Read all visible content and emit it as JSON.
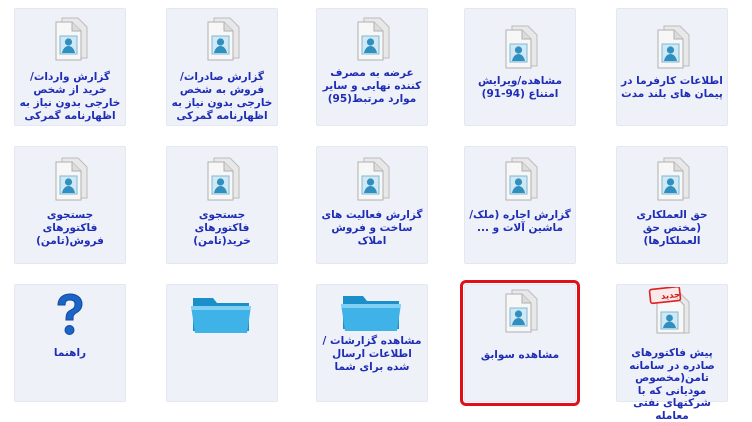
{
  "tiles": [
    {
      "label": "اطلاعات کارفرما در پیمان های بلند مدت",
      "icon": "document-user-icon"
    },
    {
      "label": "مشاهده/ویرایش امتناع (94-91)",
      "icon": "document-user-icon"
    },
    {
      "label": "عرضه به مصرف کننده نهایی و سایر موارد مرتبط(95)",
      "icon": "document-user-icon"
    },
    {
      "label": "گزارش صادرات/فروش به شخص خارجی بدون نیاز به اظهارنامه گمرکی",
      "icon": "document-user-icon"
    },
    {
      "label": "گزارش واردات/خرید از شخص خارجی بدون نیاز به اظهارنامه گمرکی",
      "icon": "document-user-icon"
    },
    {
      "label": "حق العملکاری (مختص حق العملکارها)",
      "icon": "document-user-icon"
    },
    {
      "label": "گزارش اجاره (ملک/ماشین آلات و ...",
      "icon": "document-user-icon"
    },
    {
      "label": "گزارش فعالیت های ساخت و فروش املاک",
      "icon": "document-user-icon"
    },
    {
      "label": "جستجوی فاکتورهای خرید(تامن)",
      "icon": "document-user-icon"
    },
    {
      "label": "جستجوی فاکتورهای فروش(تامن)",
      "icon": "document-user-icon"
    },
    {
      "label": "پیش فاکتورهای صادره در سامانه تامن(مخصوص مودیانی که با شرکتهای نفتی معامله",
      "icon": "new-document-icon",
      "badge": "جدید"
    },
    {
      "label": "مشاهده سوابق",
      "icon": "document-user-icon",
      "selected": true
    },
    {
      "label": "مشاهده گزارشات /اطلاعات ارسال شده برای شما",
      "icon": "folder-icon"
    },
    {
      "label": "",
      "icon": "folder-icon"
    },
    {
      "label": "راهنما",
      "icon": "help-icon"
    }
  ],
  "colors": {
    "label": "#1f2db5",
    "selection": "#e0101a",
    "tile_bg": "#eef1f8"
  }
}
